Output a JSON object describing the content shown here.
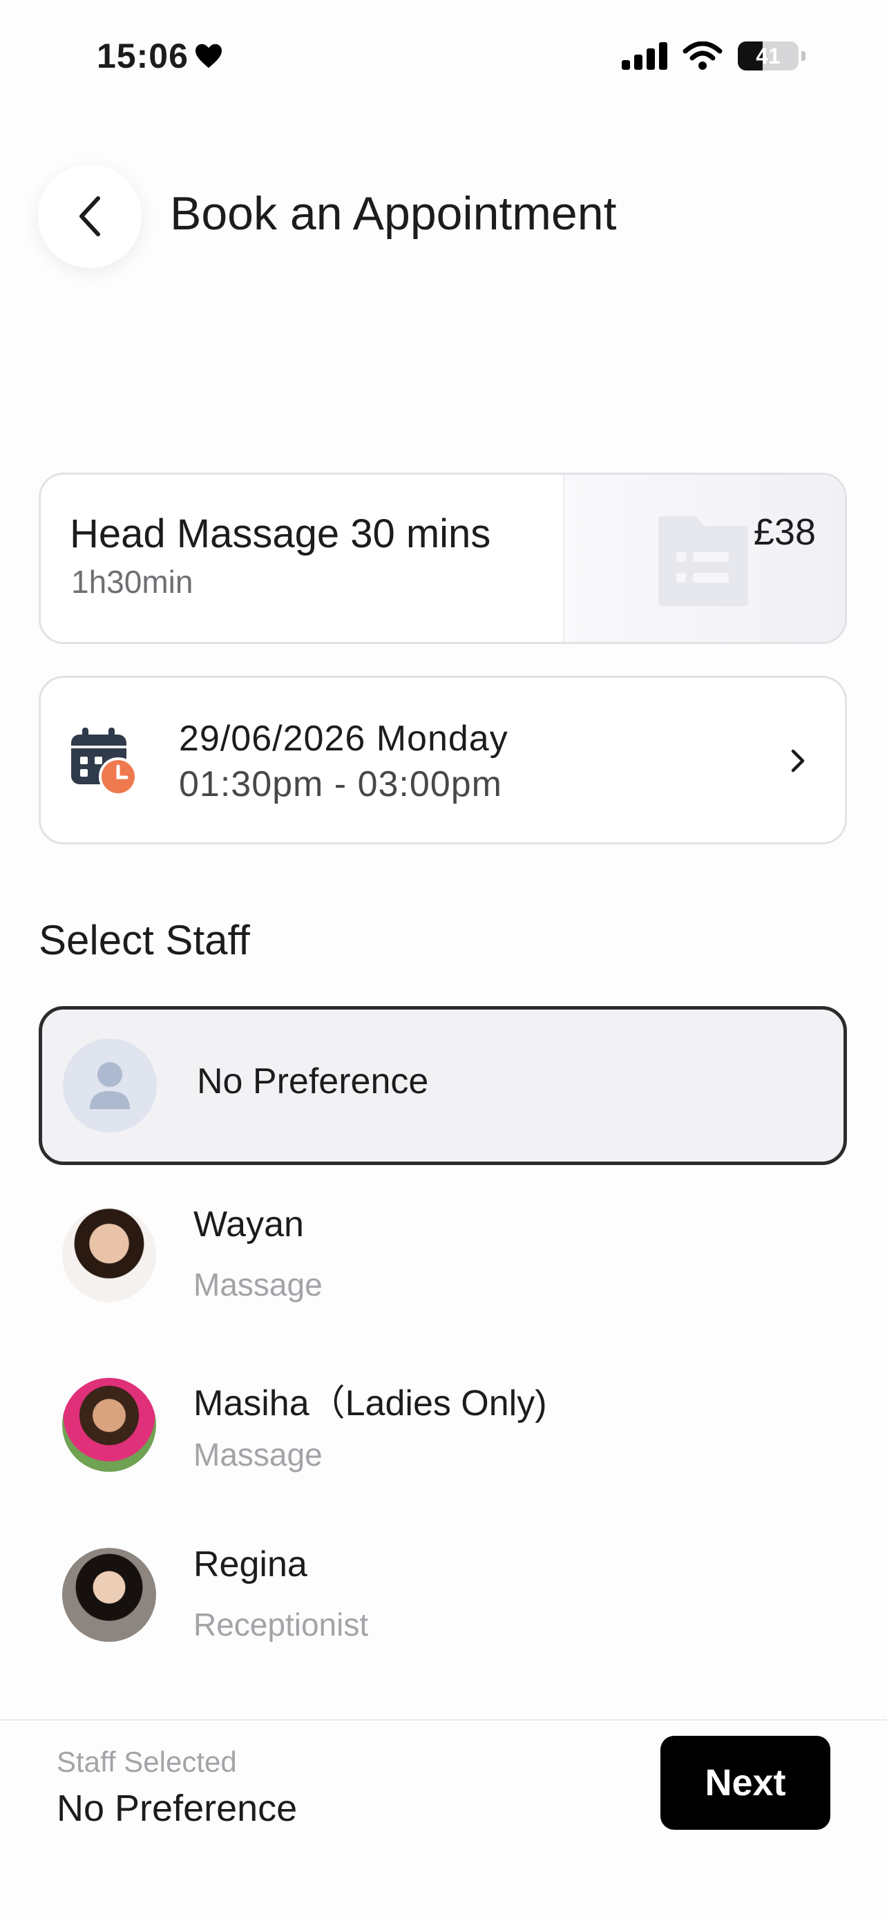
{
  "status_bar": {
    "time": "15:06",
    "battery": "41",
    "battery_percent": 41
  },
  "header": {
    "title": "Book an Appointment"
  },
  "service": {
    "name": "Head Massage 30 mins",
    "duration": "1h30min",
    "price": "£38"
  },
  "appointment": {
    "date": "29/06/2026  Monday",
    "time": "01:30pm - 03:00pm"
  },
  "staff_section": {
    "title": "Select Staff"
  },
  "staff": [
    {
      "name": "No Preference",
      "role": ""
    },
    {
      "name": "Wayan",
      "role": "Massage"
    },
    {
      "name": "Masiha（Ladies Only)",
      "role": "Massage"
    },
    {
      "name": "Regina",
      "role": "Receptionist"
    }
  ],
  "footer": {
    "selected_label": "Staff Selected",
    "selected_value": "No Preference",
    "next_label": "Next"
  },
  "colors": {
    "accent": "#000000",
    "selected_border": "#2c2c2e",
    "calendar_icon": "#2f3a4a",
    "clock_badge": "#f07a50"
  }
}
